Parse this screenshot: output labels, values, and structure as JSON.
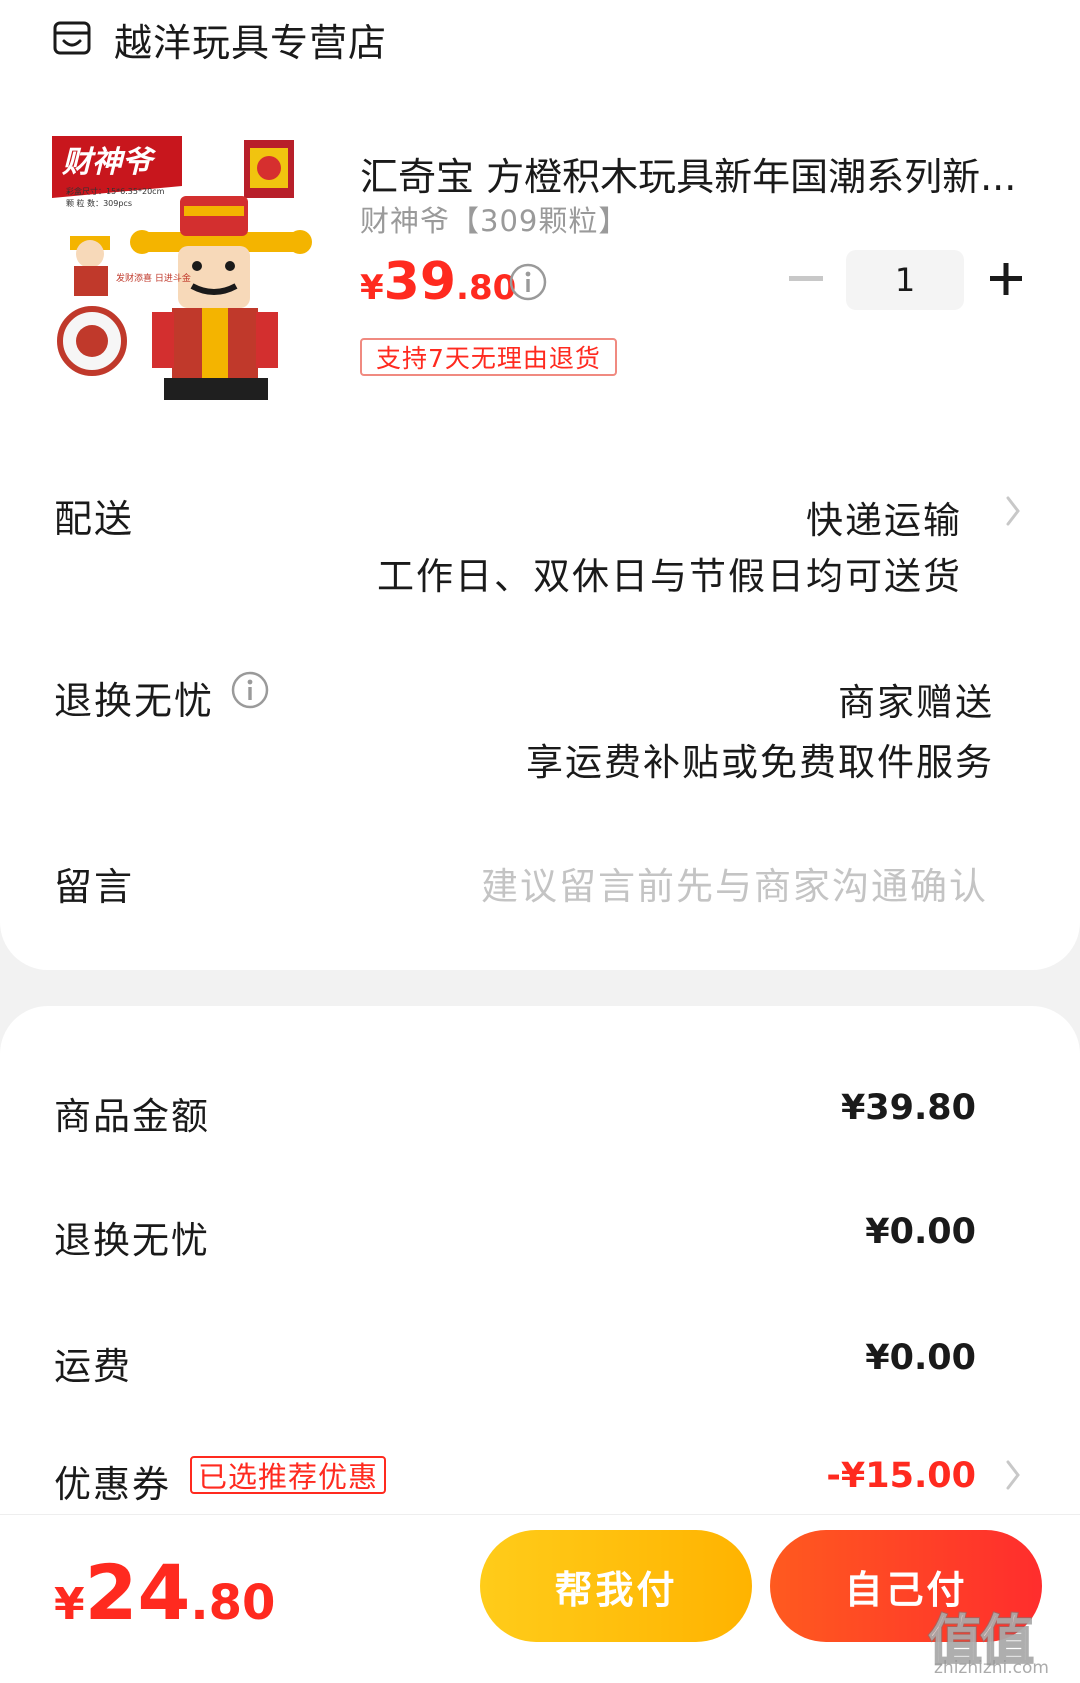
{
  "store": {
    "name": "越洋玩具专营店",
    "icon": "store-icon"
  },
  "product": {
    "title": "汇奇宝 方橙积木玩具新年国潮系列新...",
    "spec": "财神爷【309颗粒】",
    "price_currency": "¥",
    "price_int": "39",
    "price_dec": ".80",
    "quantity": "1",
    "return_tag": "支持7天无理由退货",
    "image_texts": {
      "banner": "财神爷",
      "spec1": "彩盒尺寸：15*6.35*20cm",
      "spec2": "颗 粒 数：309pcs",
      "slogan": "发财添喜 日进斗金"
    }
  },
  "delivery": {
    "label": "配送",
    "method": "快递运输",
    "detail": "工作日、双休日与节假日均可送货"
  },
  "return_service": {
    "label": "退换无忧",
    "provider": "商家赠送",
    "detail": "享运费补贴或免费取件服务"
  },
  "message": {
    "label": "留言",
    "placeholder": "建议留言前先与商家沟通确认"
  },
  "summary": {
    "goods_label": "商品金额",
    "goods_value": "¥39.80",
    "return_label": "退换无忧",
    "return_value": "¥0.00",
    "shipping_label": "运费",
    "shipping_value": "¥0.00",
    "coupon_label": "优惠券",
    "coupon_tag": "已选推荐优惠",
    "coupon_value": "-¥15.00"
  },
  "footer": {
    "total_currency": "¥",
    "total_int": "24",
    "total_dec": ".80",
    "help_pay": "帮我付",
    "self_pay": "自己付"
  },
  "watermark": {
    "text": "值值值",
    "sub": "zhizhizhi.com"
  },
  "colors": {
    "accent": "#ff2a1f",
    "yellow_btn": "#ffc107",
    "red_btn": "#ff3d24"
  }
}
